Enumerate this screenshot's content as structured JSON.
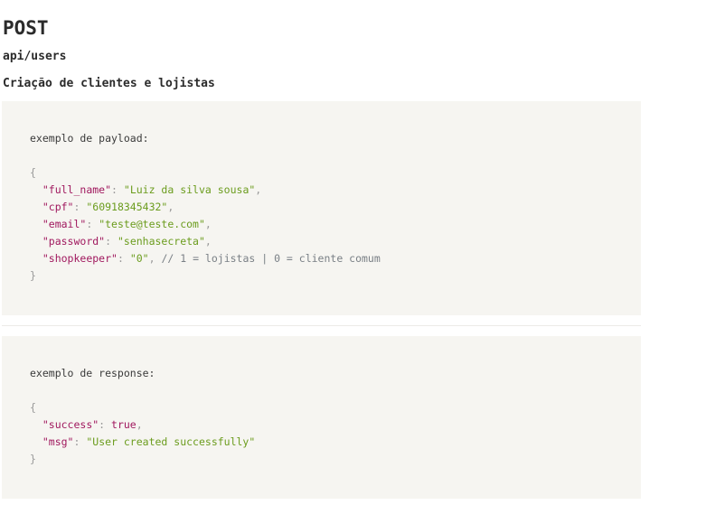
{
  "header": {
    "method": "POST",
    "endpoint": "api/users",
    "description": "Criação de clientes e lojistas"
  },
  "request_example": {
    "label": "exemplo de payload:",
    "open_brace": "{",
    "close_brace": "}",
    "fields": [
      {
        "key": "\"full_name\"",
        "sep": ": ",
        "value": "\"Luiz da silva sousa\"",
        "trail": ",",
        "comment": ""
      },
      {
        "key": "\"cpf\"",
        "sep": ": ",
        "value": "\"60918345432\"",
        "trail": ",",
        "comment": ""
      },
      {
        "key": "\"email\"",
        "sep": ": ",
        "value": "\"teste@teste.com\"",
        "trail": ",",
        "comment": ""
      },
      {
        "key": "\"password\"",
        "sep": ": ",
        "value": "\"senhasecreta\"",
        "trail": ",",
        "comment": ""
      },
      {
        "key": "\"shopkeeper\"",
        "sep": ": ",
        "value": "\"0\"",
        "trail": ",",
        "comment": " // 1 = lojistas | 0 = cliente comum"
      }
    ]
  },
  "response_example": {
    "label": "exemplo de response:",
    "open_brace": "{",
    "close_brace": "}",
    "fields": [
      {
        "key": "\"success\"",
        "sep": ": ",
        "value": "true",
        "trail": ",",
        "comment": ""
      },
      {
        "key": "\"msg\"",
        "sep": ": ",
        "value": "\"User created successfully\"",
        "trail": "",
        "comment": ""
      }
    ]
  },
  "colors": {
    "key": "#a0185e",
    "string": "#6b9c1d",
    "comment": "#7a8086",
    "code_background": "#f6f5f1"
  }
}
